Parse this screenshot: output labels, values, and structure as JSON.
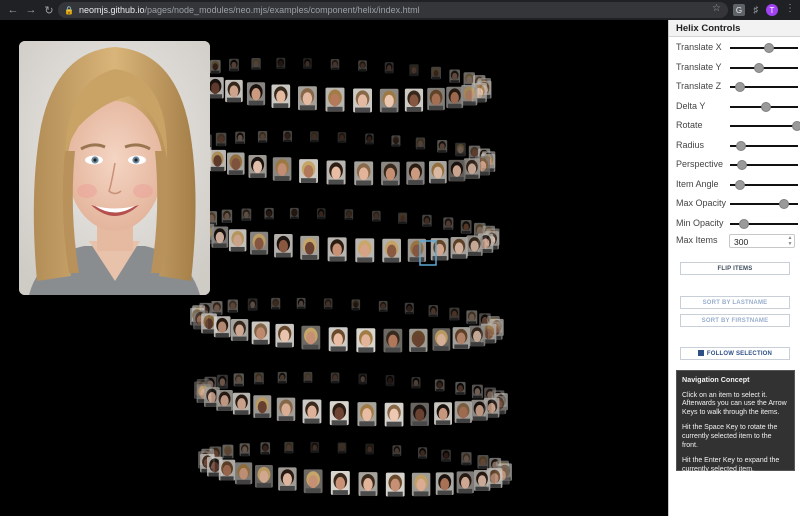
{
  "browser": {
    "url_host": "neomjs.github.io",
    "url_path": "/pages/node_modules/neo.mjs/examples/component/helix/index.html",
    "profile_initial": "T"
  },
  "panel": {
    "title": "Helix Controls",
    "sliders": [
      {
        "label": "Translate X",
        "value": 0.57
      },
      {
        "label": "Translate Y",
        "value": 0.42
      },
      {
        "label": "Translate Z",
        "value": 0.15
      },
      {
        "label": "Delta Y",
        "value": 0.53
      },
      {
        "label": "Rotate",
        "value": 0.98
      },
      {
        "label": "Radius",
        "value": 0.16
      },
      {
        "label": "Perspective",
        "value": 0.18
      },
      {
        "label": "Item Angle",
        "value": 0.14
      },
      {
        "label": "Max Opacity",
        "value": 0.8
      },
      {
        "label": "Min Opacity",
        "value": 0.2
      }
    ],
    "max_items": {
      "label": "Max Items",
      "value": "300"
    },
    "buttons": {
      "flip": "FLIP ITEMS",
      "sort_lastname": "SORT BY LASTNAME",
      "sort_firstname": "SORT BY FIRSTNAME",
      "follow": "FOLLOW SELECTION"
    },
    "nav": {
      "title": "Navigation Concept",
      "p1": "Click on an item to select it. Afterwards you can use the Arrow Keys to walk through the items.",
      "p2": "Hit the Space Key to rotate the currently selected item to the front.",
      "p3": "Hit the Enter Key to expand the currently selected item."
    }
  },
  "colors": {
    "panel_bg": "#ffffff",
    "stage_bg": "#000000",
    "accent": "#2e4f86"
  },
  "icons": [
    "back-arrow-icon",
    "forward-arrow-icon",
    "reload-icon",
    "lock-icon",
    "star-icon",
    "extension-icon",
    "puzzle-icon",
    "profile-avatar",
    "kebab-menu-icon"
  ]
}
